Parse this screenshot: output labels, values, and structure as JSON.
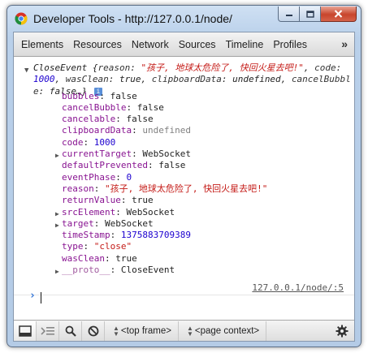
{
  "window": {
    "title": "Developer Tools - http://127.0.0.1/node/"
  },
  "tabs": [
    "Elements",
    "Resources",
    "Network",
    "Sources",
    "Timeline",
    "Profiles"
  ],
  "tabs_overflow": "»",
  "console": {
    "object_summary": {
      "type_name": "CloseEvent",
      "reason_key": "reason",
      "reason_value": "\"孩子, 地球太危险了, 快回火星去吧!\"",
      "code_key": "code",
      "code_value": "1000",
      "wasClean_key": "wasClean",
      "wasClean_value": "true",
      "clipboardData_key": "clipboardData",
      "clipboardData_value": "undefined",
      "cancelBubble_key": "cancelBubble",
      "cancelBubble_value": "false…}",
      "info_badge": "i"
    },
    "properties": [
      {
        "name": "bubbles",
        "value": "false",
        "kind": "plain",
        "expandable": false
      },
      {
        "name": "cancelBubble",
        "value": "false",
        "kind": "plain",
        "expandable": false
      },
      {
        "name": "cancelable",
        "value": "false",
        "kind": "plain",
        "expandable": false
      },
      {
        "name": "clipboardData",
        "value": "undefined",
        "kind": "undef",
        "expandable": false
      },
      {
        "name": "code",
        "value": "1000",
        "kind": "num",
        "expandable": false
      },
      {
        "name": "currentTarget",
        "value": "WebSocket",
        "kind": "plain",
        "expandable": true
      },
      {
        "name": "defaultPrevented",
        "value": "false",
        "kind": "plain",
        "expandable": false
      },
      {
        "name": "eventPhase",
        "value": "0",
        "kind": "num",
        "expandable": false
      },
      {
        "name": "reason",
        "value": "\"孩子, 地球太危险了, 快回火星去吧!\"",
        "kind": "str",
        "expandable": false
      },
      {
        "name": "returnValue",
        "value": "true",
        "kind": "plain",
        "expandable": false
      },
      {
        "name": "srcElement",
        "value": "WebSocket",
        "kind": "plain",
        "expandable": true
      },
      {
        "name": "target",
        "value": "WebSocket",
        "kind": "plain",
        "expandable": true
      },
      {
        "name": "timeStamp",
        "value": "1375883709389",
        "kind": "num",
        "expandable": false
      },
      {
        "name": "type",
        "value": "\"close\"",
        "kind": "str",
        "expandable": false
      },
      {
        "name": "wasClean",
        "value": "true",
        "kind": "plain",
        "expandable": false
      },
      {
        "name": "__proto__",
        "value": "CloseEvent",
        "kind": "plain",
        "expandable": true
      }
    ],
    "source_link": "127.0.0.1/node/:5",
    "prompt_symbol": "›"
  },
  "statusbar": {
    "frame_select": "<top frame>",
    "context_select": "<page context>"
  },
  "icons": {
    "app": "chrome-icon",
    "dock": "dock-icon",
    "drawer": "console-drawer-icon",
    "search": "search-icon",
    "clear": "clear-console-icon",
    "settings": "gear-icon"
  },
  "colors": {
    "property_name": "#881391",
    "string_value": "#c41a16",
    "number_value": "#1c00cf",
    "undefined_value": "#808080",
    "prompt": "#2b6fd6"
  }
}
